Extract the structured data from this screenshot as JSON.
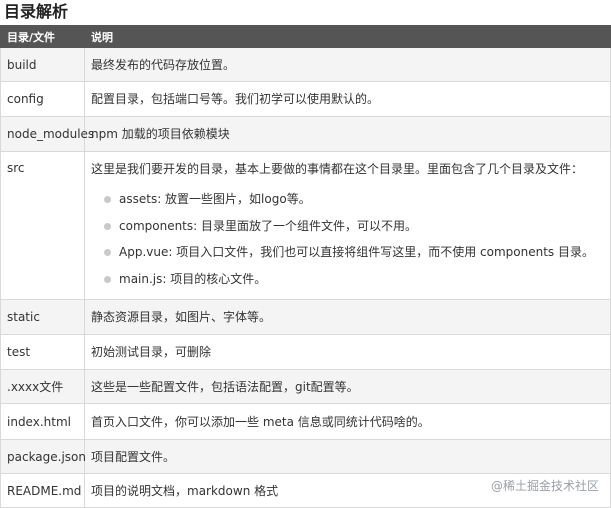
{
  "title": "目录解析",
  "table": {
    "headers": [
      "目录/文件",
      "说明"
    ],
    "rows": [
      {
        "name": "build",
        "desc": "最终发布的代码存放位置。"
      },
      {
        "name": "config",
        "desc": "配置目录，包括端口号等。我们初学可以使用默认的。"
      },
      {
        "name": "node_modules",
        "desc": "npm 加载的项目依赖模块"
      },
      {
        "name": "src",
        "desc": "这里是我们要开发的目录，基本上要做的事情都在这个目录里。里面包含了几个目录及文件：",
        "items": [
          "assets: 放置一些图片，如logo等。",
          "components: 目录里面放了一个组件文件，可以不用。",
          "App.vue: 项目入口文件，我们也可以直接将组件写这里，而不使用 components 目录。",
          "main.js: 项目的核心文件。"
        ]
      },
      {
        "name": "static",
        "desc": "静态资源目录，如图片、字体等。"
      },
      {
        "name": "test",
        "desc": "初始测试目录，可删除"
      },
      {
        "name": ".xxxx文件",
        "desc": "这些是一些配置文件，包括语法配置，git配置等。"
      },
      {
        "name": "index.html",
        "desc": "首页入口文件，你可以添加一些 meta 信息或同统计代码啥的。"
      },
      {
        "name": "package.json",
        "desc": "项目配置文件。"
      },
      {
        "name": "README.md",
        "desc": "项目的说明文档，markdown 格式"
      }
    ]
  },
  "watermark": "@稀土掘金技术社区"
}
